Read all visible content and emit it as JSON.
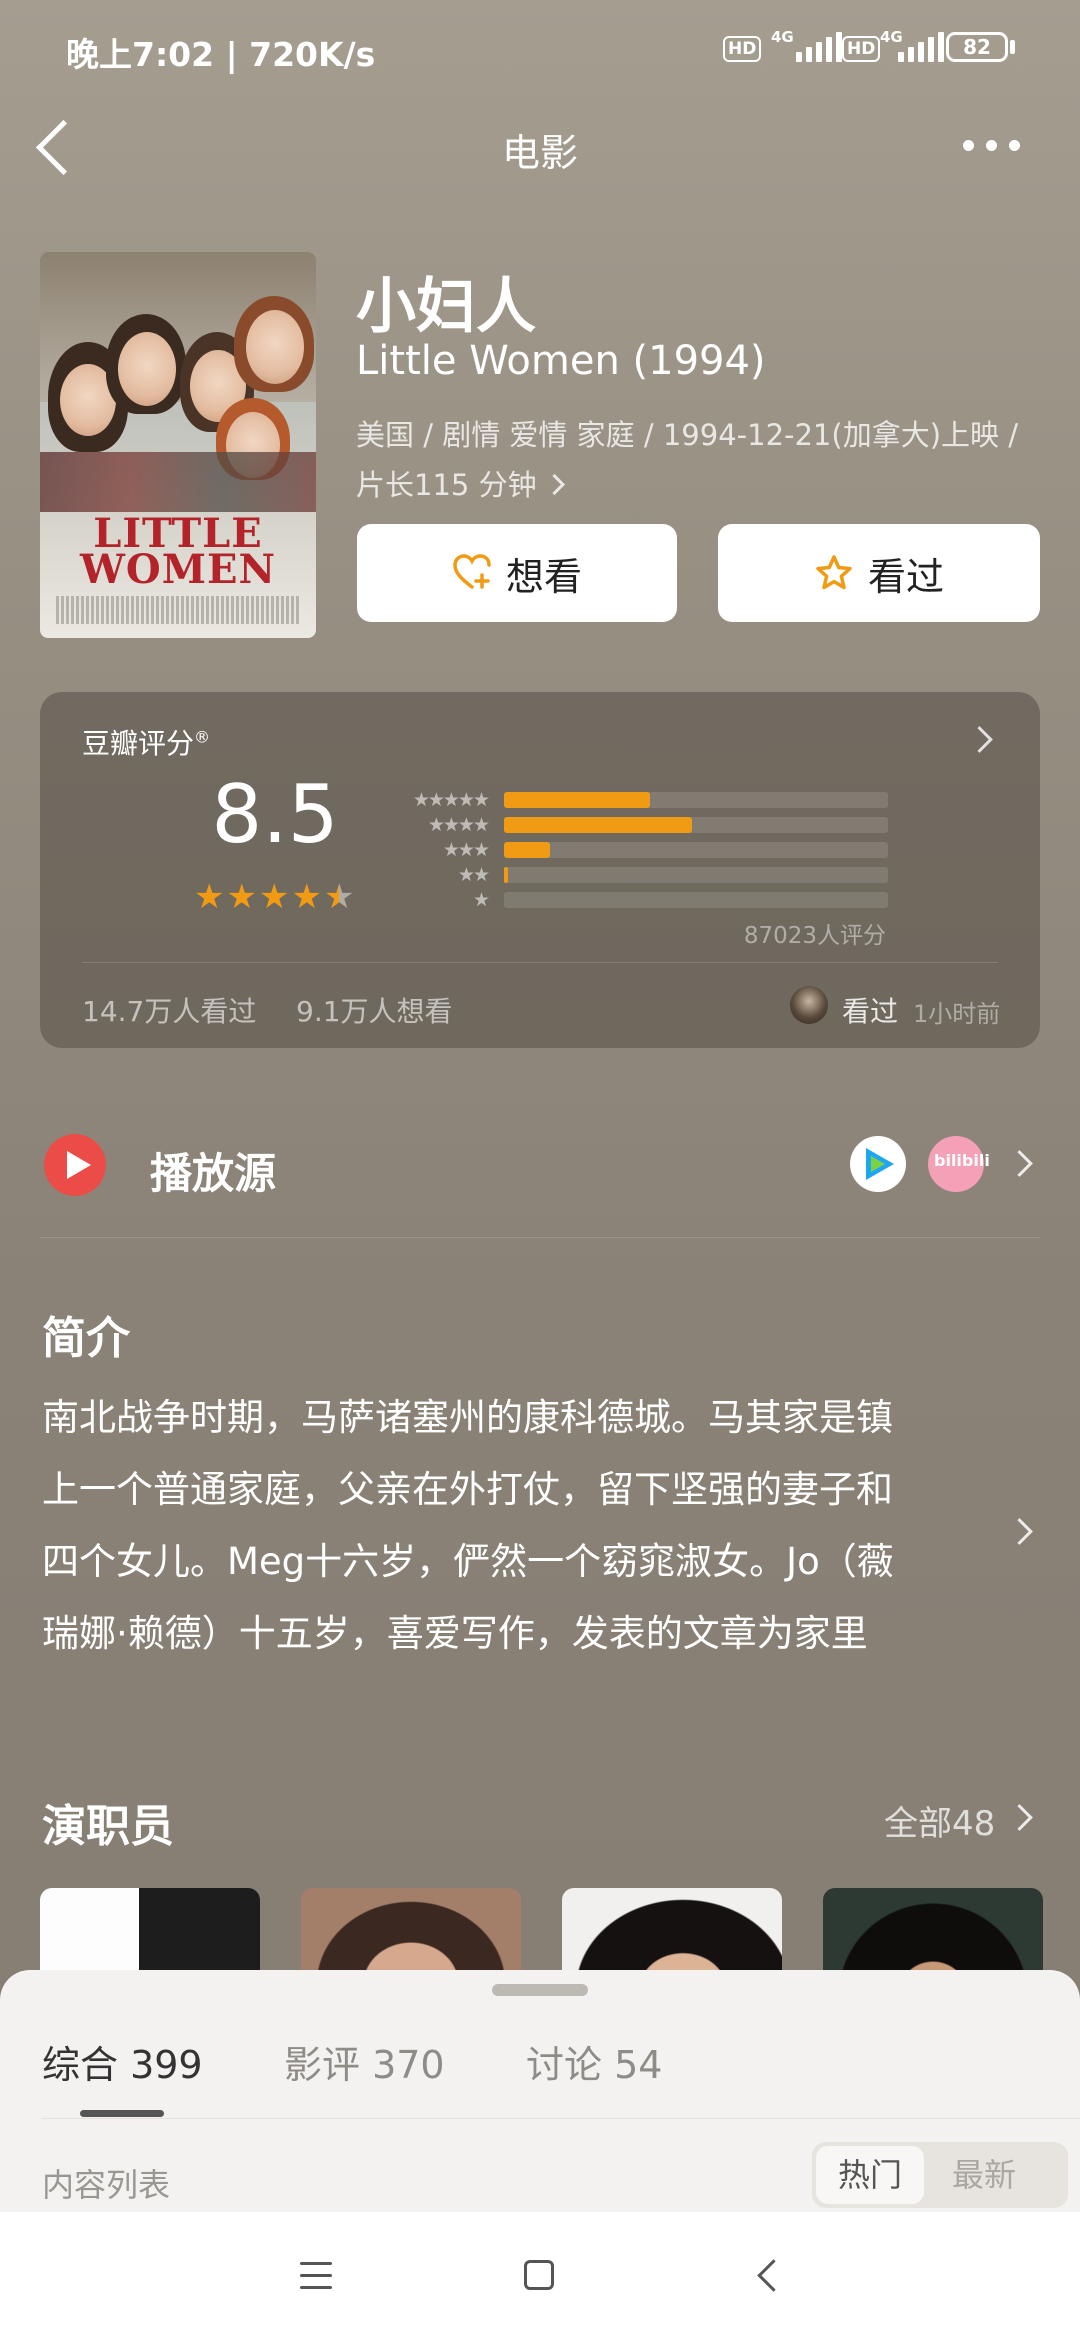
{
  "status_bar": {
    "time": "晚上7:02 | 720K/s",
    "hd_label": "HD",
    "network_label": "4G",
    "battery": "82"
  },
  "header": {
    "title": "电影"
  },
  "movie": {
    "title_zh": "小妇人",
    "title_en": "Little Women (1994)",
    "meta_line1": "美国 / 剧情 爱情 家庭 / 1994-12-21(加拿大)上映 /",
    "meta_line2": "片长115 分钟",
    "poster_title_line1": "LITTLE",
    "poster_title_line2": "WOMEN"
  },
  "actions": {
    "want_label": "想看",
    "watched_label": "看过"
  },
  "rating": {
    "label": "豆瓣评分",
    "label_mark": "®",
    "score": "8.5",
    "stars": 4.5,
    "distribution": [
      {
        "stars": "★★★★★",
        "fraction": 0.38
      },
      {
        "stars": "★★★★",
        "fraction": 0.49
      },
      {
        "stars": "★★★",
        "fraction": 0.12
      },
      {
        "stars": "★★",
        "fraction": 0.01
      },
      {
        "stars": "★",
        "fraction": 0.0
      }
    ],
    "count_text": "87023人评分",
    "seen_text": "14.7万人看过",
    "want_text": "9.1万人想看",
    "friend_status": "看过",
    "friend_time": "1小时前",
    "bar_color": "#f19b15"
  },
  "play_source": {
    "label": "播放源",
    "bili_text": "bilibili",
    "accent": "#ec4c48"
  },
  "intro": {
    "title": "简介",
    "lines": [
      "南北战争时期，马萨诸塞州的康科德城。马其家是镇",
      "上一个普通家庭，父亲在外打仗，留下坚强的妻子和",
      "四个女儿。Meg十六岁，俨然一个窈窕淑女。Jo（薇",
      "瑞娜·赖德）十五岁，喜爱写作，发表的文章为家里"
    ]
  },
  "cast": {
    "title": "演职员",
    "all_label": "全部48"
  },
  "sheet": {
    "tabs": [
      {
        "label": "综合 399"
      },
      {
        "label": "影评 370"
      },
      {
        "label": "讨论 54"
      }
    ],
    "list_label": "内容列表",
    "sort_hot": "热门",
    "sort_new": "最新"
  }
}
